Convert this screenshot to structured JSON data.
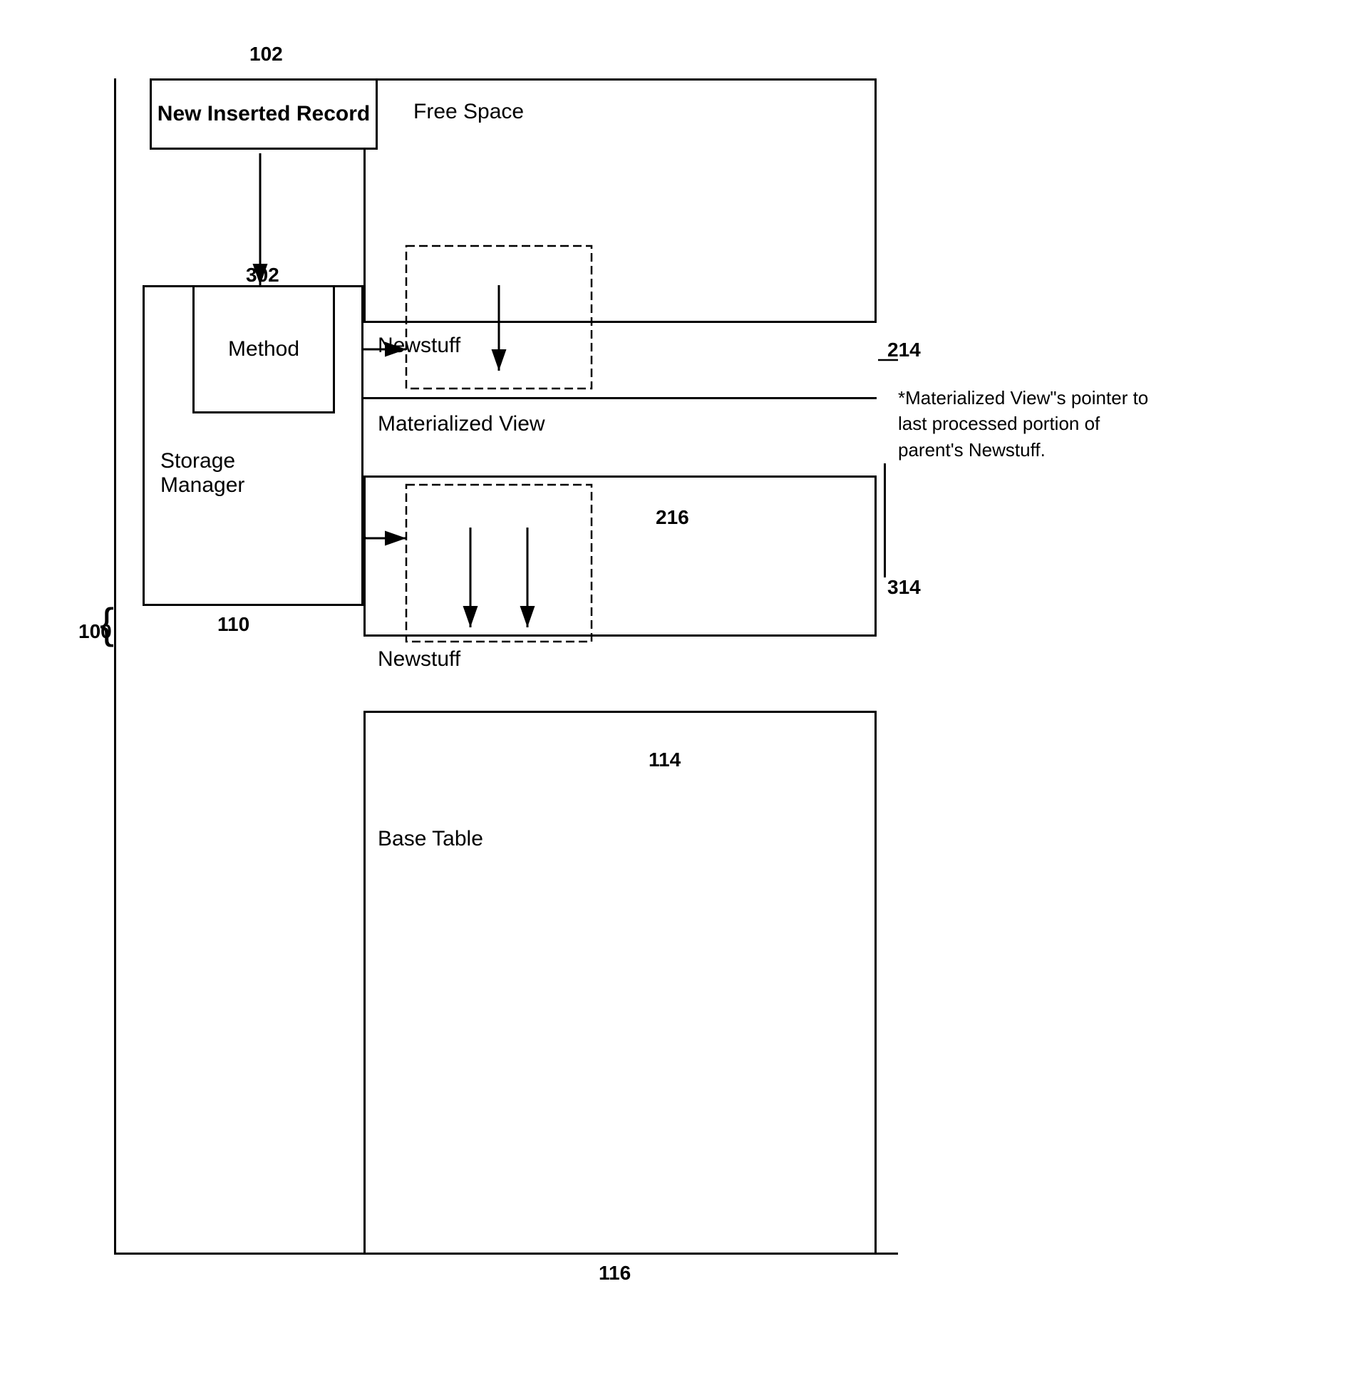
{
  "labels": {
    "label_102": "102",
    "label_100": "100",
    "label_302": "302",
    "label_110": "110",
    "label_214": "214",
    "label_216": "216",
    "label_114": "114",
    "label_116": "116",
    "label_314": "314"
  },
  "boxes": {
    "new_inserted_record": "New Inserted Record",
    "method": "Method",
    "storage_manager": "Storage\nManager",
    "free_space": "Free Space",
    "newstuff_top": "Newstuff",
    "materialized_view": "Materialized View",
    "newstuff_bottom": "Newstuff",
    "base_table": "Base Table"
  },
  "annotation": {
    "text": "*Materialized View\"s pointer to last processed portion of parent's Newstuff."
  }
}
